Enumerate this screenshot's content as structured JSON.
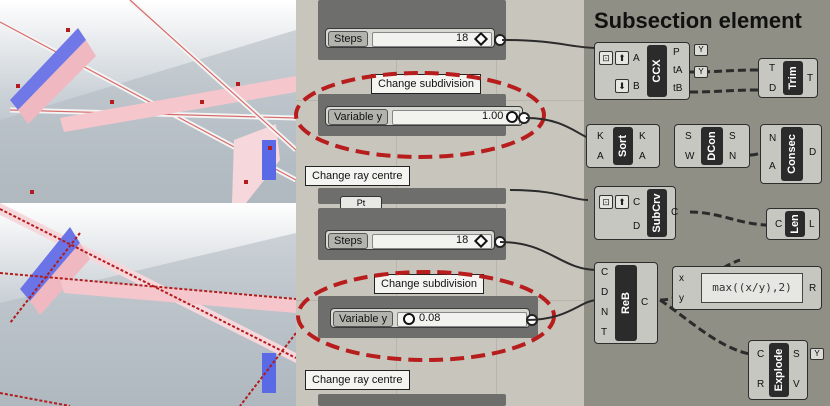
{
  "title": "Subsection element",
  "sliders": {
    "steps_top": {
      "name": "Steps",
      "value": "18"
    },
    "variable_top": {
      "name": "Variable y",
      "value": "1.00"
    },
    "steps_bottom": {
      "name": "Steps",
      "value": "18"
    },
    "variable_bottom": {
      "name": "Variable y",
      "value": "0.08"
    }
  },
  "callouts": {
    "change_subdivision": "Change subdivision",
    "change_ray_centre": "Change ray centre"
  },
  "partial_node_text": "Pt",
  "components": {
    "ccx": {
      "name": "CCX",
      "inputs": [
        "A",
        "B"
      ],
      "outputs": [
        "P",
        "tA",
        "tB"
      ]
    },
    "trim": {
      "name": "Trim",
      "inputs": [
        "T",
        "D"
      ],
      "outputs": [
        "T"
      ]
    },
    "sort": {
      "name": "Sort",
      "inputs": [
        "K",
        "A"
      ],
      "outputs": [
        "K",
        "A"
      ]
    },
    "dcon": {
      "name": "DCon",
      "inputs": [
        "S",
        "W"
      ],
      "outputs": [
        "S",
        "N"
      ]
    },
    "consec": {
      "name": "Consec",
      "inputs": [
        "N",
        "A"
      ],
      "outputs": [
        "D"
      ]
    },
    "subcrv": {
      "name": "SubCrv",
      "inputs": [
        "C",
        "D"
      ],
      "outputs": [
        "C"
      ]
    },
    "len": {
      "name": "Len",
      "inputs": [
        "C"
      ],
      "outputs": [
        "L"
      ]
    },
    "reb": {
      "name": "ReB",
      "inputs": [
        "C",
        "D",
        "N",
        "T"
      ],
      "outputs": [
        "C"
      ]
    },
    "expr": {
      "inputs": [
        "x",
        "y"
      ],
      "expression": "max((x/y),2)",
      "output": "R"
    },
    "explode": {
      "name": "Explode",
      "inputs": [
        "C",
        "R"
      ],
      "outputs": [
        "S",
        "V"
      ]
    }
  },
  "icons": {
    "ccx_badge": "Y",
    "ccx_badge_2": "Y",
    "explode_badge": "Y"
  },
  "colors": {
    "highlight_ellipse": "#b81d1d",
    "slider_group": "#6e6e6c",
    "component_core": "#2b2b2b"
  }
}
